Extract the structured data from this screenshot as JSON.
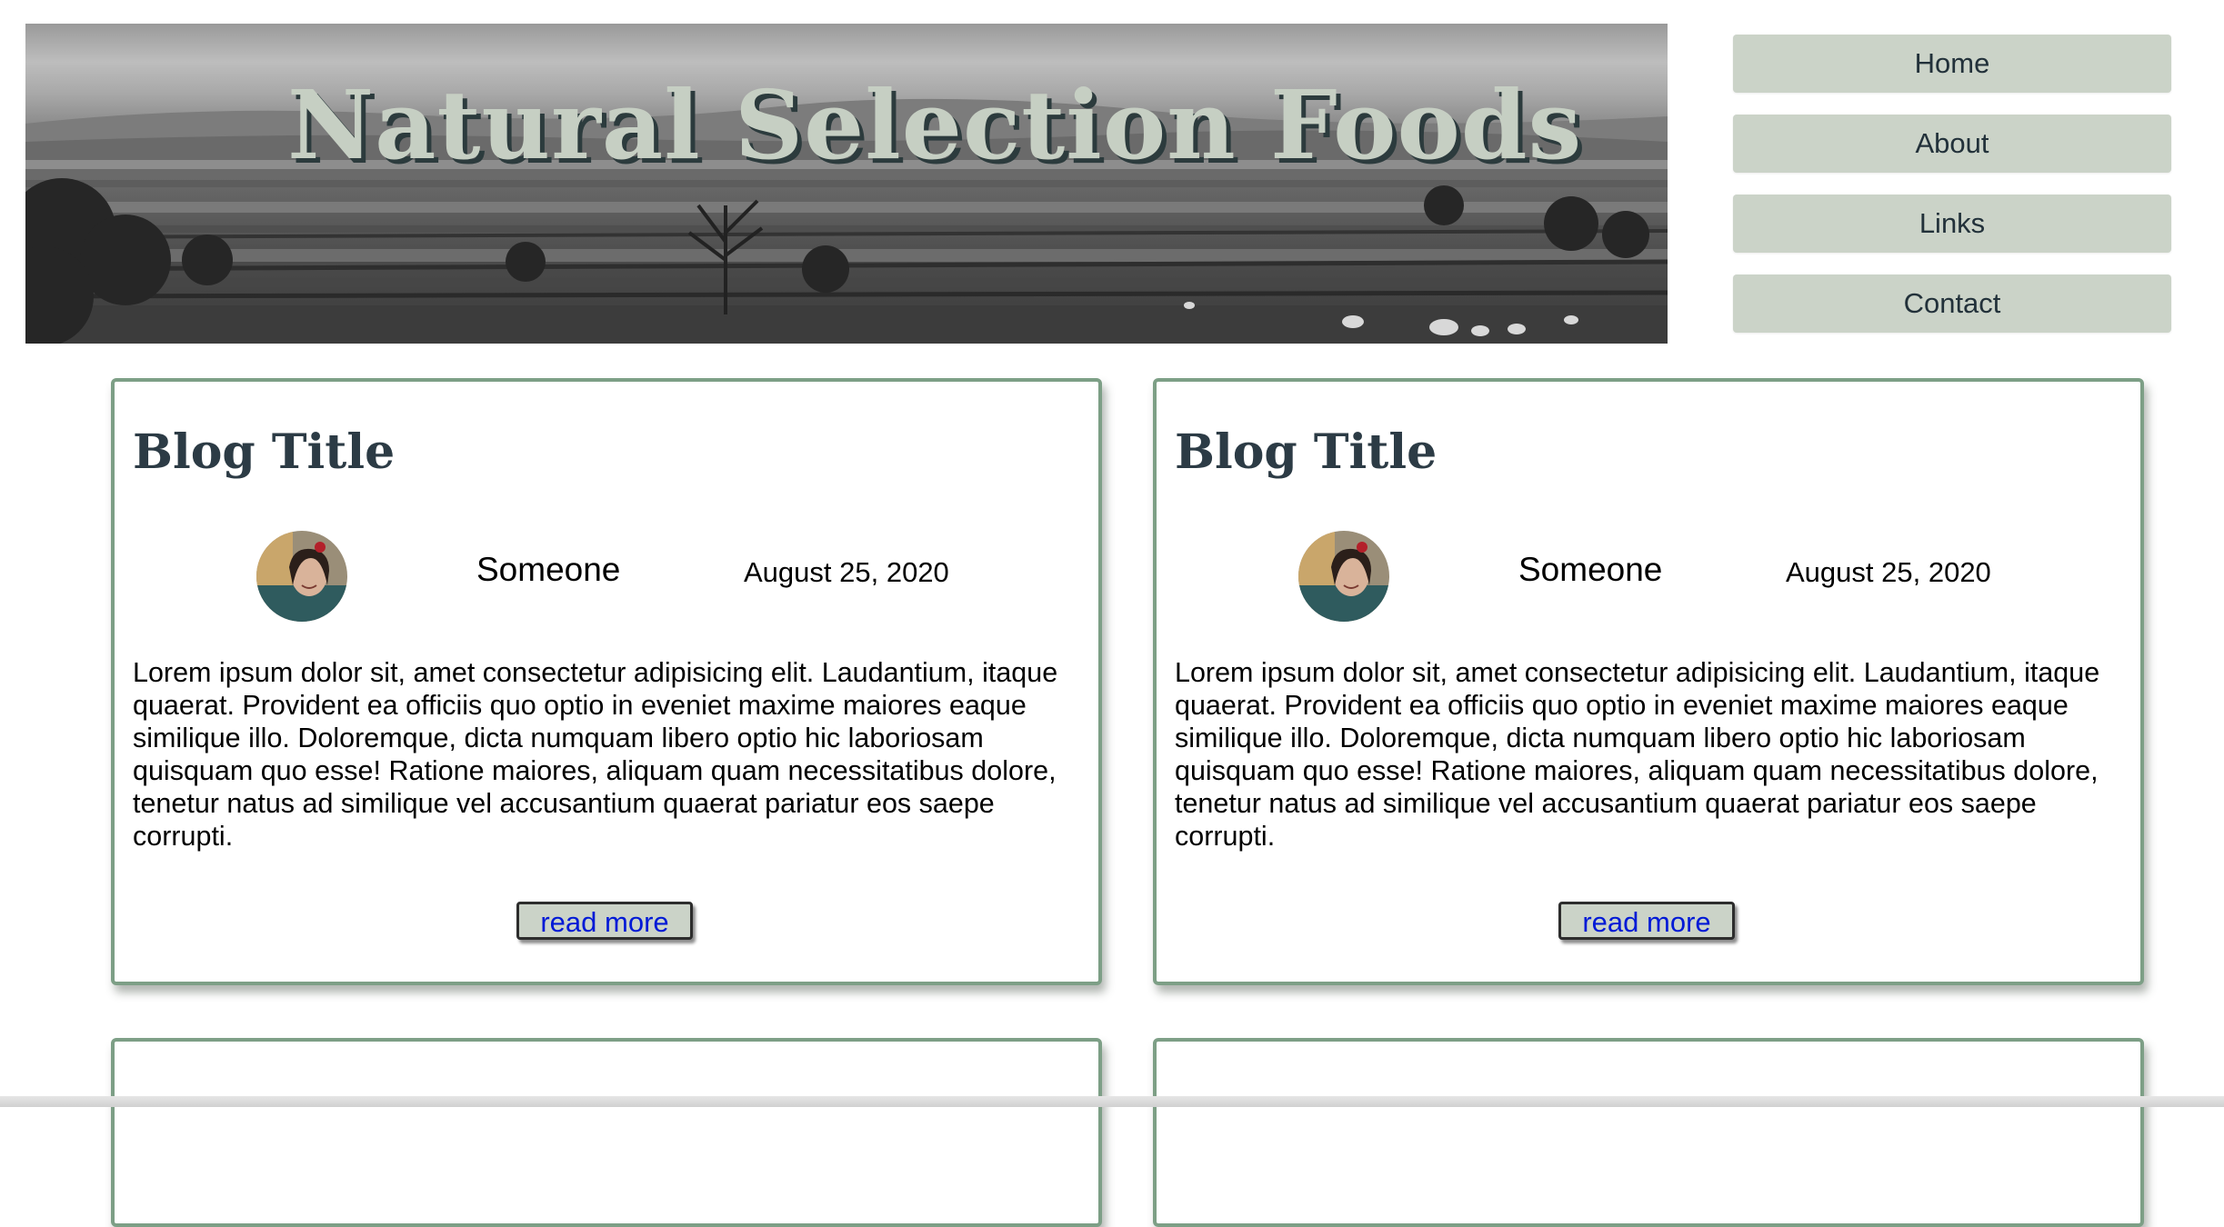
{
  "header": {
    "title": "Natural Selection Foods"
  },
  "nav": {
    "items": [
      {
        "label": "Home"
      },
      {
        "label": "About"
      },
      {
        "label": "Links"
      },
      {
        "label": "Contact"
      }
    ]
  },
  "posts": [
    {
      "title": "Blog Title",
      "author": "Someone",
      "date": "August 25, 2020",
      "excerpt": "Lorem ipsum dolor sit, amet consectetur adipisicing elit. Laudantium, itaque quaerat. Provident ea officiis quo optio in eveniet maxime maiores eaque similique illo. Doloremque, dicta numquam libero optio hic laboriosam quisquam quo esse! Ratione maiores, aliquam quam necessitatibus dolore, tenetur natus ad similique vel accusantium quaerat pariatur eos saepe corrupti.",
      "read_more": "read more"
    },
    {
      "title": "Blog Title",
      "author": "Someone",
      "date": "August 25, 2020",
      "excerpt": "Lorem ipsum dolor sit, amet consectetur adipisicing elit. Laudantium, itaque quaerat. Provident ea officiis quo optio in eveniet maxime maiores eaque similique illo. Doloremque, dicta numquam libero optio hic laboriosam quisquam quo esse! Ratione maiores, aliquam quam necessitatibus dolore, tenetur natus ad similique vel accusantium quaerat pariatur eos saepe corrupti.",
      "read_more": "read more"
    }
  ],
  "colors": {
    "accent_border": "#7d9f86",
    "button_bg": "#cbd3c8",
    "title_text": "#2c3b45",
    "link": "#0019d6"
  }
}
